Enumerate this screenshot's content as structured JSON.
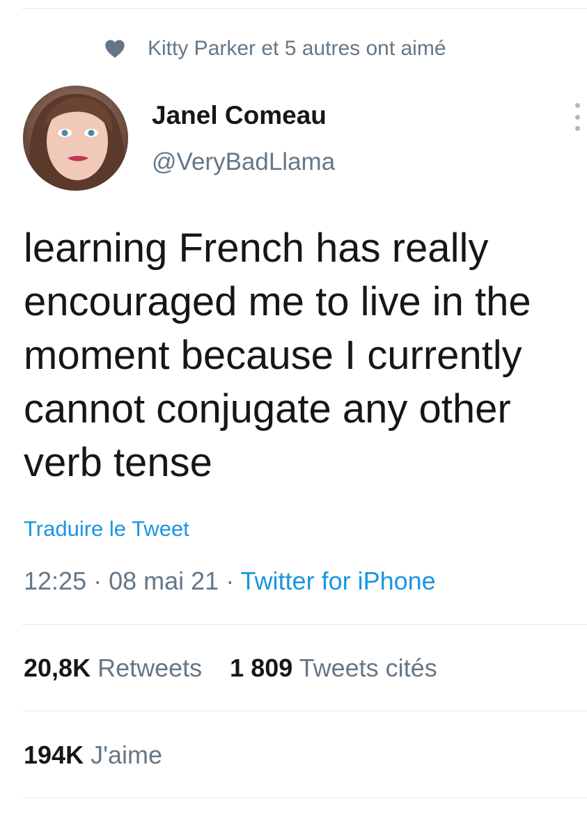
{
  "social_context": {
    "icon": "heart-icon",
    "text": "Kitty Parker et 5 autres ont aimé"
  },
  "author": {
    "avatar_icon": "avatar",
    "display_name": "Janel Comeau",
    "handle": "@VeryBadLlama"
  },
  "more_icon": "more-vertical-icon",
  "tweet": {
    "lines": [
      "learning French has really",
      "encouraged me to live in the",
      "moment because I currently",
      "cannot conjugate any other",
      "verb tense"
    ],
    "translate_label": "Traduire le Tweet",
    "time": "12:25",
    "separator": " · ",
    "date": "08 mai 21",
    "source": "Twitter for iPhone"
  },
  "stats": {
    "retweets_count": "20,8K",
    "retweets_label": "Retweets",
    "quotes_count": "1 809",
    "quotes_label": "Tweets cités",
    "likes_count": "194K",
    "likes_label": "J'aime"
  },
  "colors": {
    "text_primary": "#14171a",
    "text_secondary": "#657786",
    "link": "#1b95e0",
    "divider": "#e1e8ed"
  }
}
